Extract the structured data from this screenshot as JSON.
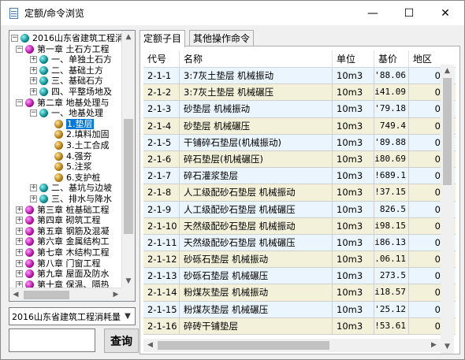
{
  "window": {
    "title": "定额/命令浏览",
    "minimize_glyph": "—",
    "maximize_glyph": "☐",
    "close_glyph": "✕"
  },
  "tree": {
    "items": [
      {
        "text": "2016山东省建筑工程消",
        "icon": "teal-ball-icon",
        "expander": "−",
        "level": 0
      },
      {
        "text": "第一章 土石方工程",
        "icon": "magenta-ball-icon",
        "expander": "−",
        "level": 1
      },
      {
        "text": "一、单独土石方",
        "icon": "teal-ball-icon",
        "expander": "+",
        "level": 2
      },
      {
        "text": "二、基础土方",
        "icon": "teal-ball-icon",
        "expander": "+",
        "level": 2
      },
      {
        "text": "三、基础石方",
        "icon": "teal-ball-icon",
        "expander": "+",
        "level": 2
      },
      {
        "text": "四、平整场地及",
        "icon": "teal-ball-icon",
        "expander": "+",
        "level": 2
      },
      {
        "text": "第二章 地基处理与",
        "icon": "magenta-ball-icon",
        "expander": "−",
        "level": 1
      },
      {
        "text": "一、地基处理",
        "icon": "teal-ball-icon",
        "expander": "−",
        "level": 2
      },
      {
        "text": "1.垫层",
        "icon": "brown-ball-icon",
        "expander": "",
        "level": 3,
        "selected": true
      },
      {
        "text": "2.填料加固",
        "icon": "brown-ball-icon",
        "expander": "",
        "level": 3
      },
      {
        "text": "3.土工合成",
        "icon": "brown-ball-icon",
        "expander": "",
        "level": 3
      },
      {
        "text": "4.强夯",
        "icon": "brown-ball-icon",
        "expander": "",
        "level": 3
      },
      {
        "text": "5.注浆",
        "icon": "brown-ball-icon",
        "expander": "",
        "level": 3
      },
      {
        "text": "6.支护桩",
        "icon": "brown-ball-icon",
        "expander": "",
        "level": 3
      },
      {
        "text": "二、基坑与边坡",
        "icon": "teal-ball-icon",
        "expander": "+",
        "level": 2
      },
      {
        "text": "三、排水与降水",
        "icon": "teal-ball-icon",
        "expander": "+",
        "level": 2
      },
      {
        "text": "第三章 桩基础工程",
        "icon": "magenta-ball-icon",
        "expander": "+",
        "level": 1
      },
      {
        "text": "第四章 砌筑工程",
        "icon": "magenta-ball-icon",
        "expander": "+",
        "level": 1
      },
      {
        "text": "第五章 钢筋及混凝",
        "icon": "magenta-ball-icon",
        "expander": "+",
        "level": 1
      },
      {
        "text": "第六章 金属结构工",
        "icon": "magenta-ball-icon",
        "expander": "+",
        "level": 1
      },
      {
        "text": "第七章 木结构工程",
        "icon": "magenta-ball-icon",
        "expander": "+",
        "level": 1
      },
      {
        "text": "第八章 门窗工程",
        "icon": "magenta-ball-icon",
        "expander": "+",
        "level": 1
      },
      {
        "text": "第九章 屋面及防水",
        "icon": "magenta-ball-icon",
        "expander": "+",
        "level": 1
      },
      {
        "text": "第十章 保温、隔热",
        "icon": "magenta-ball-icon",
        "expander": "+",
        "level": 1
      }
    ]
  },
  "quota_library": {
    "selected": "2016山东省建筑工程消耗量"
  },
  "search": {
    "value": "",
    "button_label": "查询"
  },
  "tabs": [
    {
      "label": "定额子目",
      "active": true
    },
    {
      "label": "其他操作命令",
      "active": false
    }
  ],
  "grid": {
    "columns": [
      "代号",
      "名称",
      "单位",
      "基价",
      "地区"
    ],
    "rows": [
      [
        "2-1-1",
        "3:7灰土垫层 机械振动",
        "10m3",
        "'88.06",
        "0"
      ],
      [
        "2-1-2",
        "3:7灰土垫层 机械碾压",
        "10m3",
        "i41.09",
        "0"
      ],
      [
        "2-1-3",
        "砂垫层 机械振动",
        "10m3",
        "'79.18",
        "0"
      ],
      [
        "2-1-4",
        "砂垫层 机械碾压",
        "10m3",
        "749.4",
        "0"
      ],
      [
        "2-1-5",
        "干铺碎石垫层(机械振动)",
        "10m3",
        "'89.88",
        "0"
      ],
      [
        "2-1-6",
        "碎石垫层(机械碾压)",
        "10m3",
        "i80.69",
        "0"
      ],
      [
        "2-1-7",
        "碎石灌浆垫层",
        "10m3",
        "!689.1",
        "0"
      ],
      [
        "2-1-8",
        "人工级配砂石垫层 机械振动",
        "10m3",
        "!37.15",
        "0"
      ],
      [
        "2-1-9",
        "人工级配砂石垫层 机械碾压",
        "10m3",
        "826.5",
        "0"
      ],
      [
        "2-1-10",
        "天然级配砂石垫层 机械振动",
        "10m3",
        "i98.15",
        "0"
      ],
      [
        "2-1-11",
        "天然级配砂石垫层 机械碾压",
        "10m3",
        "i86.13",
        "0"
      ],
      [
        "2-1-12",
        "砂砾石垫层 机械振动",
        "10m3",
        ".06.11",
        "0"
      ],
      [
        "2-1-13",
        "砂砾石垫层 机械碾压",
        "10m3",
        "273.5",
        "0"
      ],
      [
        "2-1-14",
        "粉煤灰垫层 机械振动",
        "10m3",
        "i18.57",
        "0"
      ],
      [
        "2-1-15",
        "粉煤灰垫层 机械碾压",
        "10m3",
        "'25.12",
        "0"
      ],
      [
        "2-1-16",
        "碎砖干铺垫层",
        "10m3",
        "!53.61",
        "0"
      ]
    ]
  }
}
